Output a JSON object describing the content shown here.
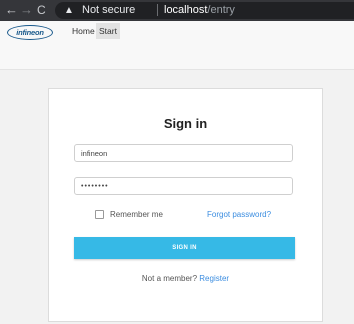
{
  "browser": {
    "back_glyph": "←",
    "forward_glyph": "→",
    "reload_glyph": "C",
    "warning_glyph": "▲",
    "security_text": "Not secure",
    "host": "localhost",
    "path": "/entry"
  },
  "navbar": {
    "logo_text": "infineon",
    "home_label": "Home",
    "start_label": "Start"
  },
  "signin": {
    "title": "Sign in",
    "username_value": "infineon",
    "password_value": "••••••••",
    "remember_label": "Remember me",
    "forgot_label": "Forgot password?",
    "button_label": "SIGN IN",
    "member_text": "Not a member?",
    "register_label": "Register"
  },
  "colors": {
    "accent": "#36b9e6",
    "link": "#3b8de0",
    "brand": "#1a5a8c"
  }
}
